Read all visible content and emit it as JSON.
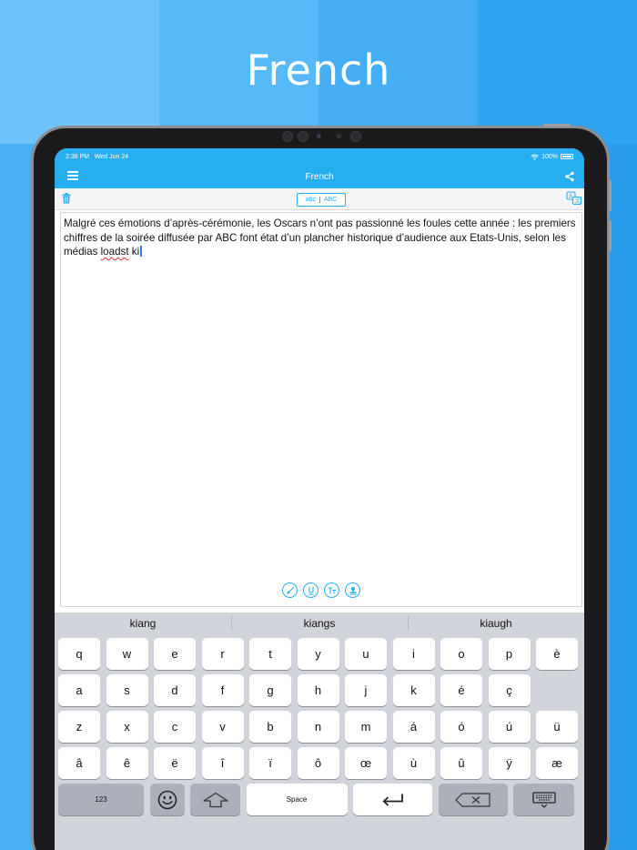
{
  "headline": "French",
  "status": {
    "time": "2:38 PM",
    "date": "Wed Jun 24",
    "battery": "100%"
  },
  "nav": {
    "title": "French"
  },
  "toolbar": {
    "case_lower": "abc",
    "case_upper": "ABC"
  },
  "editor": {
    "text_before": "Malgré ces émotions d’après-cérémonie, les Oscars n’ont pas passionné les foules cette année : les premiers chiffres de la soirée diffusée par ABC font état d’un plancher historique d’audience aux Etats-Unis, selon les médias ",
    "misspelled_word": "loadst",
    "text_after": " ki"
  },
  "suggestions": [
    "kiang",
    "kiangs",
    "kiaugh"
  ],
  "keyboard": {
    "row1": [
      "q",
      "w",
      "e",
      "r",
      "t",
      "y",
      "u",
      "i",
      "o",
      "p",
      "è"
    ],
    "row2": [
      "a",
      "s",
      "d",
      "f",
      "g",
      "h",
      "j",
      "k",
      "é",
      "ç"
    ],
    "row3": [
      "z",
      "x",
      "c",
      "v",
      "b",
      "n",
      "m",
      "á",
      "ó",
      "ú",
      "ü"
    ],
    "row4": [
      "â",
      "ê",
      "ë",
      "î",
      "ï",
      "ô",
      "œ",
      "ù",
      "û",
      "ÿ",
      "æ"
    ],
    "numbers_label": "123",
    "space_label": "Space"
  },
  "colors": {
    "accent": "#27aef1",
    "misspell_underline": "#e0302f",
    "keyboard_bg": "#d1d4da"
  },
  "icons": {
    "menu": "hamburger-icon",
    "share": "share-icon",
    "trash": "trash-icon",
    "translate": "translate-icon",
    "emoji": "emoji-icon",
    "shift": "shift-arrow-icon",
    "return": "return-arrow-icon",
    "delete": "backspace-icon",
    "hide_keyboard": "keyboard-hide-icon"
  }
}
